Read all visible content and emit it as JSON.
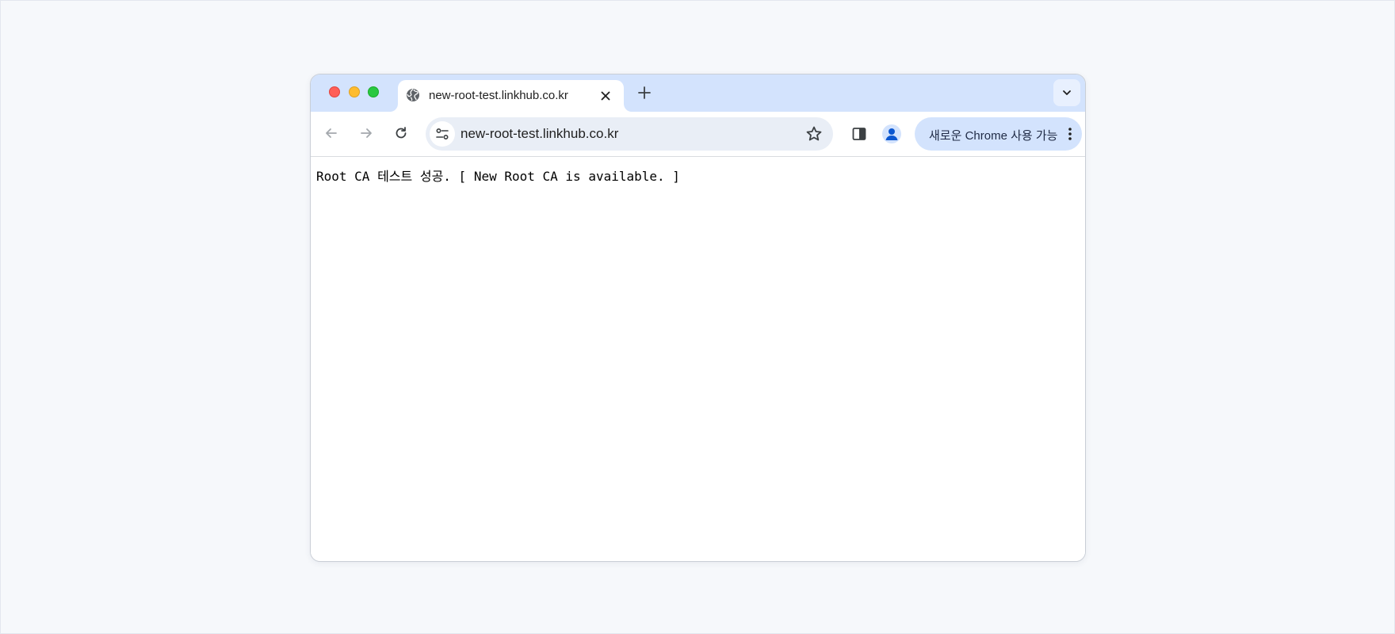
{
  "tab": {
    "title": "new-root-test.linkhub.co.kr",
    "favicon": "globe-icon"
  },
  "omnibox": {
    "url": "new-root-test.linkhub.co.kr"
  },
  "toolbar": {
    "update_label": "새로운 Chrome 사용 가능"
  },
  "page": {
    "text": "Root CA 테스트 성공. [ New Root CA is available. ]"
  },
  "colors": {
    "tabstrip": "#d3e3fd",
    "omnibox": "#e9eef6",
    "update_chip": "#d3e3fd",
    "traffic_close": "#ff5f57",
    "traffic_minimize": "#febc2e",
    "traffic_zoom": "#28c840"
  }
}
